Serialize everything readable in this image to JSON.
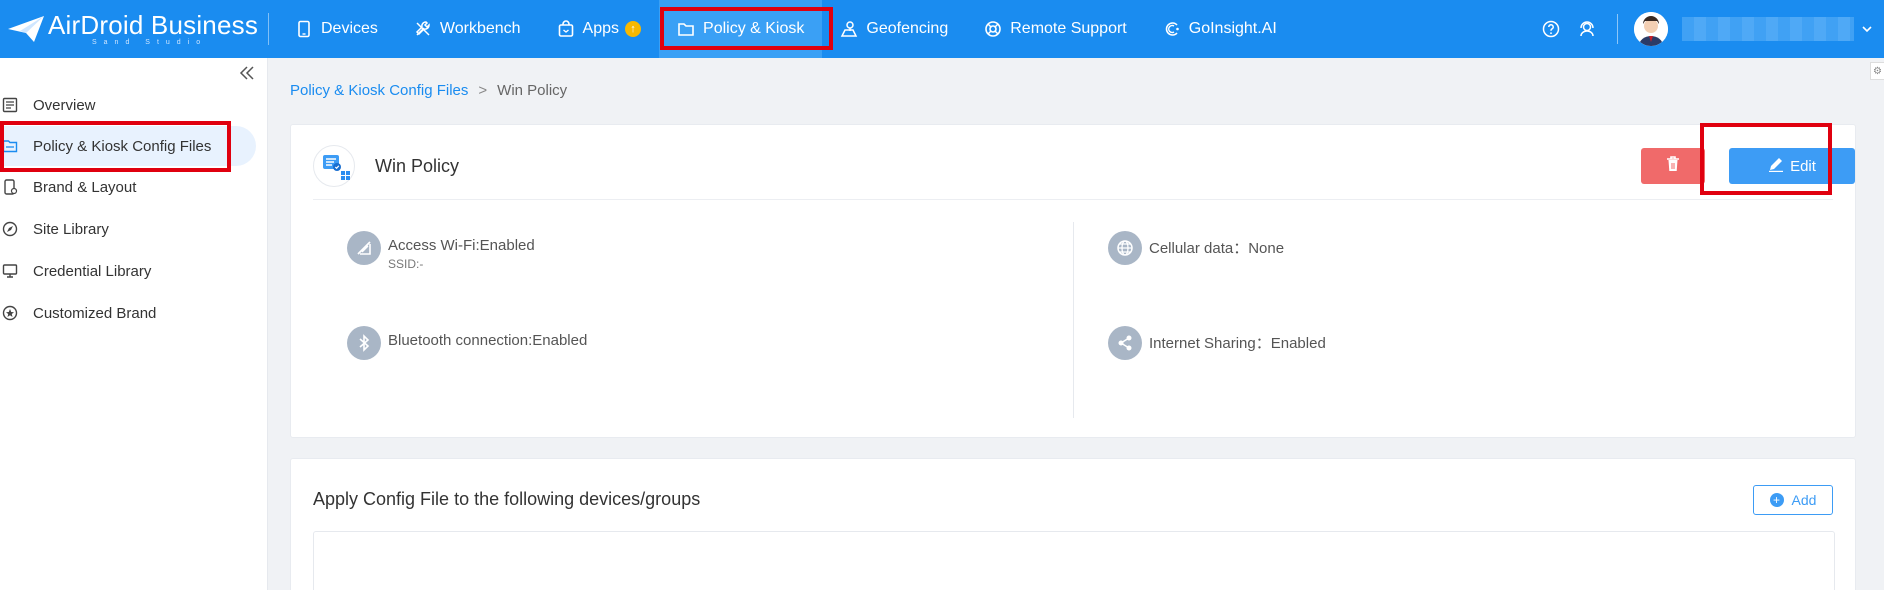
{
  "app": {
    "logo_text": "AirDroid Business",
    "logo_subtext": "Sand Studio"
  },
  "nav": {
    "items": [
      {
        "label": "Devices"
      },
      {
        "label": "Workbench"
      },
      {
        "label": "Apps"
      },
      {
        "label": "Policy & Kiosk"
      },
      {
        "label": "Geofencing"
      },
      {
        "label": "Remote Support"
      },
      {
        "label": "GoInsight.AI"
      }
    ],
    "apps_badge": "↑",
    "active": "Policy & Kiosk"
  },
  "sidebar": {
    "items": [
      {
        "label": "Overview",
        "icon": "list-icon"
      },
      {
        "label": "Policy & Kiosk Config Files",
        "icon": "folder-icon"
      },
      {
        "label": "Brand & Layout",
        "icon": "phone-icon"
      },
      {
        "label": "Site Library",
        "icon": "compass-icon"
      },
      {
        "label": "Credential Library",
        "icon": "monitor-icon"
      },
      {
        "label": "Customized Brand",
        "icon": "star-icon"
      }
    ],
    "active": "Policy & Kiosk Config Files"
  },
  "breadcrumb": {
    "parent": "Policy & Kiosk Config Files",
    "separator": ">",
    "current": "Win Policy"
  },
  "policy": {
    "title": "Win Policy",
    "edit_label": "Edit",
    "features": [
      {
        "label": "Access Wi-Fi:Enabled",
        "sub": "SSID:-",
        "icon": "wifi-icon"
      },
      {
        "label": "Cellular data：None",
        "icon": "globe-icon"
      },
      {
        "label": "Bluetooth connection:Enabled",
        "icon": "bluetooth-icon"
      },
      {
        "label": "Internet Sharing：Enabled",
        "icon": "share-icon"
      }
    ]
  },
  "apply": {
    "title": "Apply Config File to the following devices/groups",
    "add_label": "Add",
    "add_plus": "+"
  },
  "colors": {
    "brand": "#1a8cf0",
    "delete": "#f06a6a",
    "primary_button": "#3d9cf5",
    "highlight_box": "#e0000f"
  }
}
